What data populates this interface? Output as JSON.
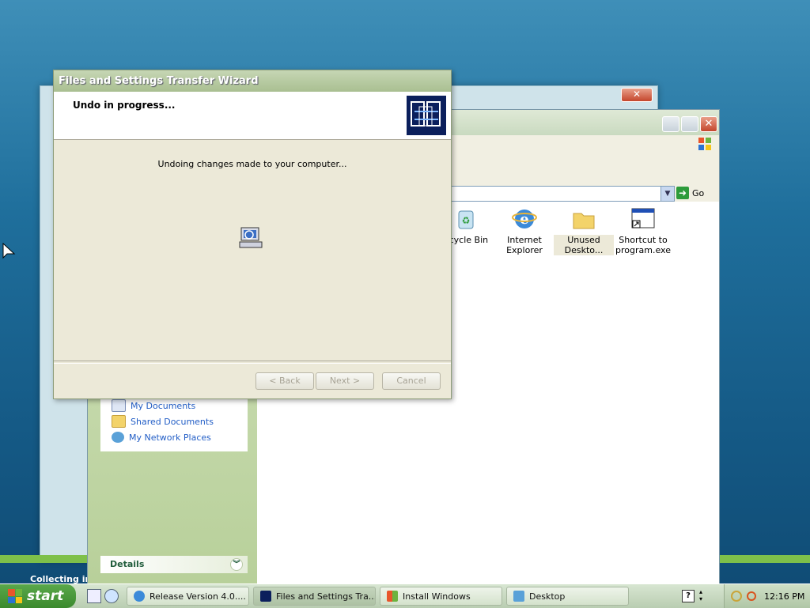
{
  "wizard": {
    "title": "Files and Settings Transfer Wizard",
    "heading": "Undo in progress...",
    "status": "Undoing changes made to your computer...",
    "buttons": {
      "back": "< Back",
      "next": "Next >",
      "cancel": "Cancel"
    }
  },
  "explorer": {
    "go_label": "Go",
    "other_places": [
      "My Documents",
      "Shared Documents",
      "My Network Places"
    ],
    "details_label": "Details",
    "icons": [
      {
        "label": "ecycle Bin",
        "icon": "recycle-bin-icon"
      },
      {
        "label": "Internet Explorer",
        "icon": "internet-explorer-icon"
      },
      {
        "label": "Unused Deskto...",
        "icon": "folder-icon"
      },
      {
        "label": "Shortcut to program.exe",
        "icon": "program-shortcut-icon"
      }
    ]
  },
  "background": {
    "collecting_text": "Collecting infc"
  },
  "taskbar": {
    "start_label": "start",
    "tasks": [
      {
        "label": "Release Version 4.0....",
        "icon": "ie-icon"
      },
      {
        "label": "Files and Settings Tra...",
        "icon": "wizard-icon"
      },
      {
        "label": "Install Windows",
        "icon": "windows-icon"
      },
      {
        "label": "Desktop",
        "icon": "desktop-icon"
      }
    ],
    "clock": "12:16 PM"
  },
  "colors": {
    "accent_green": "#3b8a2e",
    "link_blue": "#215dc6",
    "wizard_logo": "#0b1f5c"
  }
}
